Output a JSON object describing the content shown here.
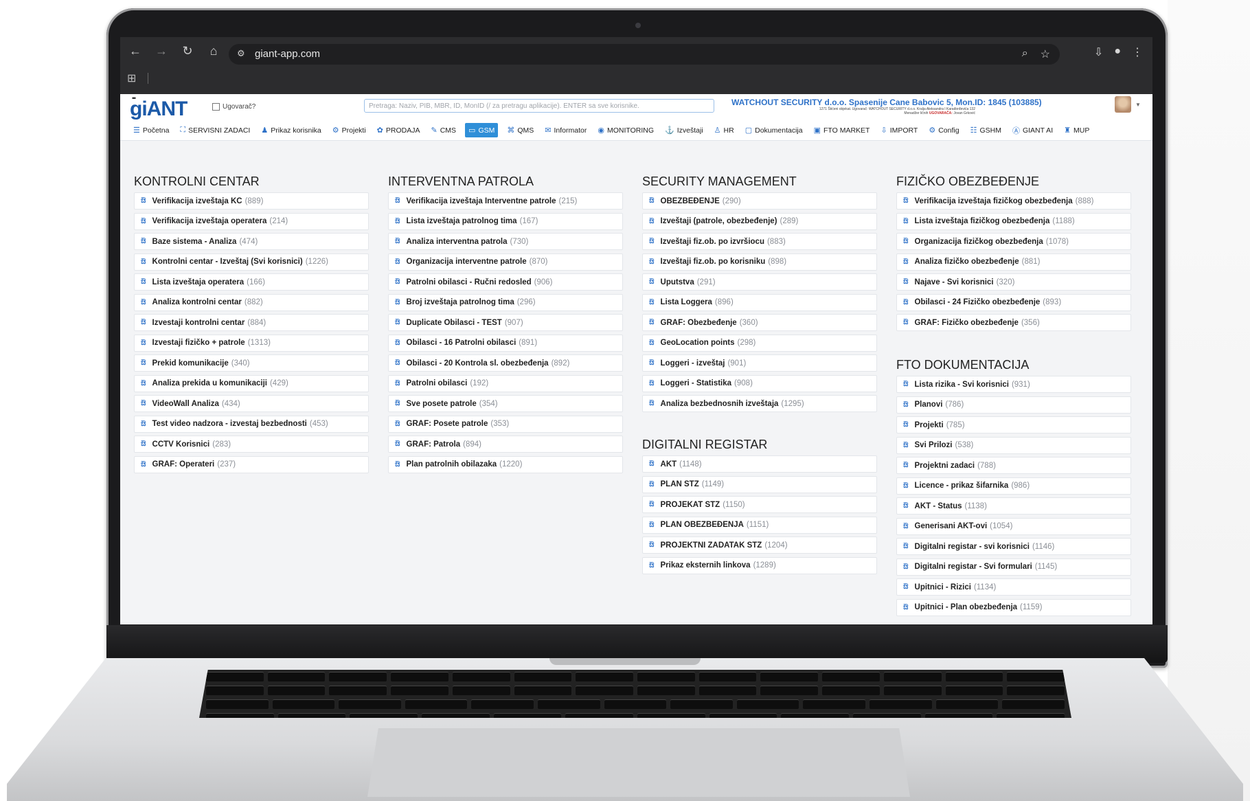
{
  "browser": {
    "url": "giant-app.com",
    "icons": [
      "back-icon",
      "forward-icon",
      "reload-icon",
      "home-icon"
    ]
  },
  "app": {
    "logo": "giANT",
    "ugovarac_label": "Ugovarač?",
    "search_placeholder": "Pretraga: Naziv, PIB, MBR, ID, MonID (/ za pretragu aplikacije). ENTER sa sve korisnike.",
    "company_line1": "WATCHOUT SECURITY d.o.o. Spasenije Cane Babovic 5, Mon.ID: 1845 (103885)",
    "company_line2": "1271 Štićeni objekat. Ugovarač: WATCHOUT SECURITY d.o.o. Kralja Aleksandra I Karađorđevića 132",
    "company_line3_prefix": "Menadžer ličnih",
    "company_line3_role": "UGOVARAČA:",
    "company_line3_name": "Jovan Grković"
  },
  "menu": [
    {
      "label": "Početna",
      "icon": "☰"
    },
    {
      "label": "SERVISNI ZADACI",
      "icon": "⛶"
    },
    {
      "label": "Prikaz korisnika",
      "icon": "♟"
    },
    {
      "label": "Projekti",
      "icon": "⚙"
    },
    {
      "label": "PRODAJA",
      "icon": "✿"
    },
    {
      "label": "CMS",
      "icon": "✎"
    },
    {
      "label": "GSM",
      "icon": "▭",
      "active": true
    },
    {
      "label": "QMS",
      "icon": "⌘"
    },
    {
      "label": "Informator",
      "icon": "✉"
    },
    {
      "label": "MONITORING",
      "icon": "◉"
    },
    {
      "label": "Izveštaji",
      "icon": "⚓"
    },
    {
      "label": "HR",
      "icon": "♙"
    },
    {
      "label": "Dokumentacija",
      "icon": "▢"
    },
    {
      "label": "FTO MARKET",
      "icon": "▣"
    },
    {
      "label": "IMPORT",
      "icon": "⇩"
    },
    {
      "label": "Config",
      "icon": "⚙"
    },
    {
      "label": "GSHM",
      "icon": "☷"
    },
    {
      "label": "GIANT AI",
      "icon": "Ⓐ"
    },
    {
      "label": "MUP",
      "icon": "♜"
    }
  ],
  "sections": {
    "kontrolni": {
      "title": "KONTROLNI CENTAR",
      "items": [
        {
          "name": "Verifikacija izveštaja KC",
          "count": "(889)"
        },
        {
          "name": "Verifikacija izveštaja operatera",
          "count": "(214)"
        },
        {
          "name": "Baze sistema - Analiza",
          "count": "(474)"
        },
        {
          "name": "Kontrolni centar - Izveštaj (Svi korisnici)",
          "count": "(1226)"
        },
        {
          "name": "Lista izveštaja operatera",
          "count": "(166)"
        },
        {
          "name": "Analiza kontrolni centar",
          "count": "(882)"
        },
        {
          "name": "Izvestaji kontrolni centar",
          "count": "(884)"
        },
        {
          "name": "Izvestaji fizičko + patrole",
          "count": "(1313)"
        },
        {
          "name": "Prekid komunikacije",
          "count": "(340)"
        },
        {
          "name": "Analiza prekida u komunikaciji",
          "count": "(429)"
        },
        {
          "name": "VideoWall Analiza",
          "count": "(434)"
        },
        {
          "name": "Test video nadzora - izvestaj bezbednosti",
          "count": "(453)"
        },
        {
          "name": "CCTV Korisnici",
          "count": "(283)"
        },
        {
          "name": "GRAF: Operateri",
          "count": "(237)"
        }
      ]
    },
    "interventna": {
      "title": "INTERVENTNA PATROLA",
      "items": [
        {
          "name": "Verifikacija izveštaja Interventne patrole",
          "count": "(215)"
        },
        {
          "name": "Lista izveštaja patrolnog tima",
          "count": "(167)"
        },
        {
          "name": "Analiza interventna patrola",
          "count": "(730)"
        },
        {
          "name": "Organizacija interventne patrole",
          "count": "(870)"
        },
        {
          "name": "Patrolni obilasci - Ručni redosled",
          "count": "(906)"
        },
        {
          "name": "Broj izveštaja patrolnog tima",
          "count": "(296)"
        },
        {
          "name": "Duplicate Obilasci - TEST",
          "count": "(907)"
        },
        {
          "name": "Obilasci - 16 Patrolni obilasci",
          "count": "(891)"
        },
        {
          "name": "Obilasci - 20 Kontrola sl. obezbeđenja",
          "count": "(892)"
        },
        {
          "name": "Patrolni obilasci",
          "count": "(192)"
        },
        {
          "name": "Sve posete patrole",
          "count": "(354)"
        },
        {
          "name": "GRAF: Posete patrole",
          "count": "(353)"
        },
        {
          "name": "GRAF: Patrola",
          "count": "(894)"
        },
        {
          "name": "Plan patrolnih obilazaka",
          "count": "(1220)"
        }
      ]
    },
    "security": {
      "title": "SECURITY MANAGEMENT",
      "items": [
        {
          "name": "OBEZBEĐENJE",
          "count": "(290)"
        },
        {
          "name": "Izveštaji (patrole, obezbeđenje)",
          "count": "(289)"
        },
        {
          "name": "Izveštaji fiz.ob. po izvršiocu",
          "count": "(883)"
        },
        {
          "name": "Izveštaji fiz.ob. po korisniku",
          "count": "(898)"
        },
        {
          "name": "Uputstva",
          "count": "(291)"
        },
        {
          "name": "Lista Loggera",
          "count": "(896)"
        },
        {
          "name": "GRAF: Obezbeđenje",
          "count": "(360)"
        },
        {
          "name": "GeoLocation points",
          "count": "(298)"
        },
        {
          "name": "Loggeri - izveštaj",
          "count": "(901)"
        },
        {
          "name": "Loggeri - Statistika",
          "count": "(908)"
        },
        {
          "name": "Analiza bezbednosnih izveštaja",
          "count": "(1295)"
        }
      ]
    },
    "digitalni": {
      "title": "DIGITALNI REGISTAR",
      "items": [
        {
          "name": "AKT",
          "count": "(1148)"
        },
        {
          "name": "PLAN STZ",
          "count": "(1149)"
        },
        {
          "name": "PROJEKAT STZ",
          "count": "(1150)"
        },
        {
          "name": "PLAN OBEZBEĐENJA",
          "count": "(1151)"
        },
        {
          "name": "PROJEKTNI ZADATAK STZ",
          "count": "(1204)"
        },
        {
          "name": "Prikaz eksternih linkova",
          "count": "(1289)"
        }
      ]
    },
    "fizicko": {
      "title": "FIZIČKO OBEZBEĐENJE",
      "items": [
        {
          "name": "Verifikacija izveštaja fizičkog obezbeđenja",
          "count": "(888)"
        },
        {
          "name": "Lista izveštaja fizičkog obezbeđenja",
          "count": "(1188)"
        },
        {
          "name": "Organizacija fizičkog obezbeđenja",
          "count": "(1078)"
        },
        {
          "name": "Analiza fizičko obezbeđenje",
          "count": "(881)"
        },
        {
          "name": "Najave - Svi korisnici",
          "count": "(320)"
        },
        {
          "name": "Obilasci - 24 Fizičko obezbeđenje",
          "count": "(893)"
        },
        {
          "name": "GRAF: Fizičko obezbeđenje",
          "count": "(356)"
        }
      ]
    },
    "fto": {
      "title": "FTO DOKUMENTACIJA",
      "items": [
        {
          "name": "Lista rizika - Svi korisnici",
          "count": "(931)"
        },
        {
          "name": "Planovi",
          "count": "(786)"
        },
        {
          "name": "Projekti",
          "count": "(785)"
        },
        {
          "name": "Svi Prilozi",
          "count": "(538)"
        },
        {
          "name": "Projektni zadaci",
          "count": "(788)"
        },
        {
          "name": "Licence - prikaz šifarnika",
          "count": "(986)"
        },
        {
          "name": "AKT - Status",
          "count": "(1138)"
        },
        {
          "name": "Generisani AKT-ovi",
          "count": "(1054)"
        },
        {
          "name": "Digitalni registar - svi korisnici",
          "count": "(1146)"
        },
        {
          "name": "Digitalni registar - Svi formulari",
          "count": "(1145)"
        },
        {
          "name": "Upitnici - Rizici",
          "count": "(1134)"
        },
        {
          "name": "Upitnici - Plan obezbeđenja",
          "count": "(1159)"
        }
      ]
    }
  }
}
